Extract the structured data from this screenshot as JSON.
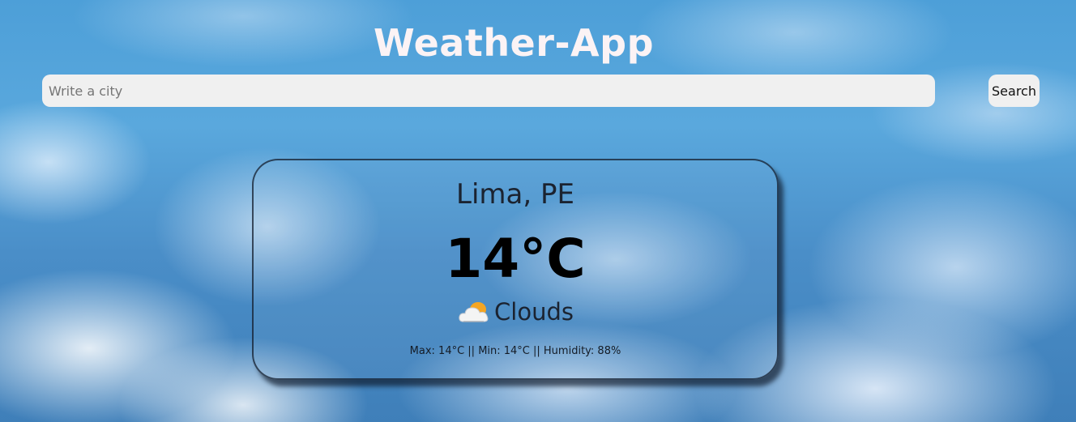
{
  "app": {
    "title": "Weather-App"
  },
  "search": {
    "placeholder": "Write a city",
    "value": "",
    "button_label": "Search"
  },
  "weather": {
    "location": "Lima, PE",
    "temperature": "14°C",
    "condition_icon": "cloud-icon",
    "condition": "Clouds",
    "details": "Max: 14°C || Min: 14°C || Humidity: 88%"
  },
  "colors": {
    "title": "#fbf3f5",
    "input_bg": "#f0f0f0",
    "card_border": "#141e2d",
    "sky": "#4d9fd8"
  }
}
